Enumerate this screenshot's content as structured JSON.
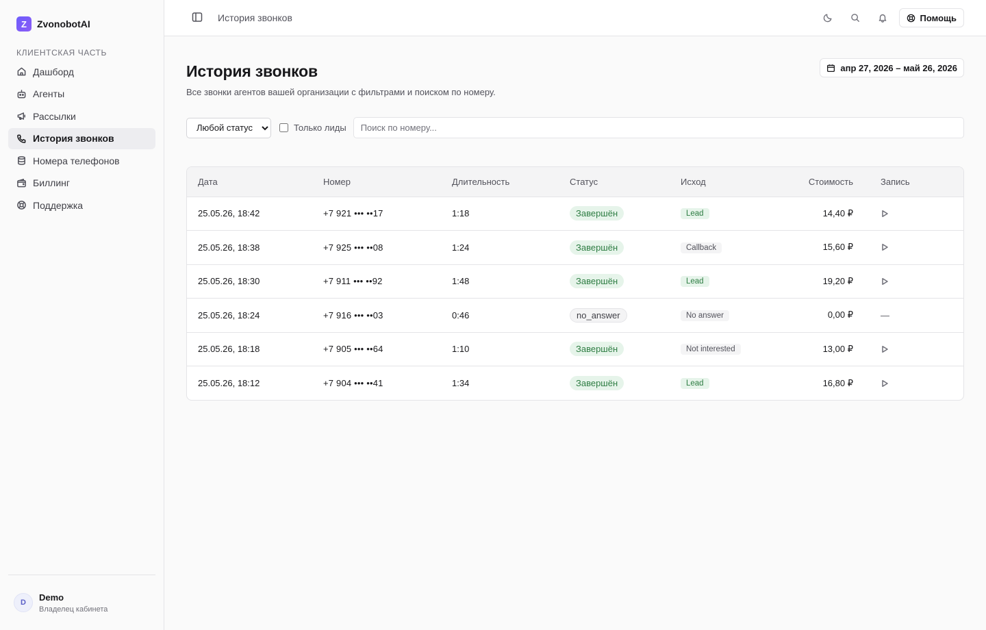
{
  "brand": {
    "logo_letter": "Z",
    "name": "ZvonobotAI"
  },
  "sidebar": {
    "section_label": "КЛИЕНТСКАЯ ЧАСТЬ",
    "items": [
      {
        "label": "Дашборд",
        "icon": "home-icon"
      },
      {
        "label": "Агенты",
        "icon": "bot-icon"
      },
      {
        "label": "Рассылки",
        "icon": "megaphone-icon"
      },
      {
        "label": "История звонков",
        "icon": "phone-icon",
        "active": true
      },
      {
        "label": "Номера телефонов",
        "icon": "database-icon"
      },
      {
        "label": "Биллинг",
        "icon": "wallet-icon"
      },
      {
        "label": "Поддержка",
        "icon": "lifebuoy-icon"
      }
    ],
    "user": {
      "initial": "D",
      "name": "Demo",
      "role": "Владелец кабинета"
    }
  },
  "topbar": {
    "breadcrumb": "История звонков",
    "help_label": "Помощь"
  },
  "page": {
    "title": "История звонков",
    "subtitle": "Все звонки агентов вашей организации с фильтрами и поиском по номеру.",
    "date_range": "апр 27, 2026 – май 26, 2026"
  },
  "filters": {
    "status_selected": "Любой статус",
    "leads_only_label": "Только лиды",
    "search_placeholder": "Поиск по номеру..."
  },
  "table": {
    "headers": {
      "date": "Дата",
      "number": "Номер",
      "duration": "Длительность",
      "status": "Статус",
      "outcome": "Исход",
      "cost": "Стоимость",
      "record": "Запись"
    },
    "rows": [
      {
        "date": "25.05.26, 18:42",
        "number": "+7 921 ••• ••17",
        "duration": "1:18",
        "status": "Завершён",
        "status_kind": "ok",
        "outcome": "Lead",
        "outcome_kind": "lead",
        "cost": "14,40 ₽",
        "record": "play"
      },
      {
        "date": "25.05.26, 18:38",
        "number": "+7 925 ••• ••08",
        "duration": "1:24",
        "status": "Завершён",
        "status_kind": "ok",
        "outcome": "Callback",
        "outcome_kind": "grey",
        "cost": "15,60 ₽",
        "record": "play"
      },
      {
        "date": "25.05.26, 18:30",
        "number": "+7 911 ••• ••92",
        "duration": "1:48",
        "status": "Завершён",
        "status_kind": "ok",
        "outcome": "Lead",
        "outcome_kind": "lead",
        "cost": "19,20 ₽",
        "record": "play"
      },
      {
        "date": "25.05.26, 18:24",
        "number": "+7 916 ••• ••03",
        "duration": "0:46",
        "status": "no_answer",
        "status_kind": "neutral",
        "outcome": "No answer",
        "outcome_kind": "grey",
        "cost": "0,00 ₽",
        "record": "—"
      },
      {
        "date": "25.05.26, 18:18",
        "number": "+7 905 ••• ••64",
        "duration": "1:10",
        "status": "Завершён",
        "status_kind": "ok",
        "outcome": "Not interested",
        "outcome_kind": "grey",
        "cost": "13,00 ₽",
        "record": "play"
      },
      {
        "date": "25.05.26, 18:12",
        "number": "+7 904 ••• ••41",
        "duration": "1:34",
        "status": "Завершён",
        "status_kind": "ok",
        "outcome": "Lead",
        "outcome_kind": "lead",
        "cost": "16,80 ₽",
        "record": "play"
      }
    ]
  },
  "colors": {
    "accent": "#6d5dfc",
    "success_bg": "#e6f4ea",
    "success_text": "#2e7d43"
  }
}
